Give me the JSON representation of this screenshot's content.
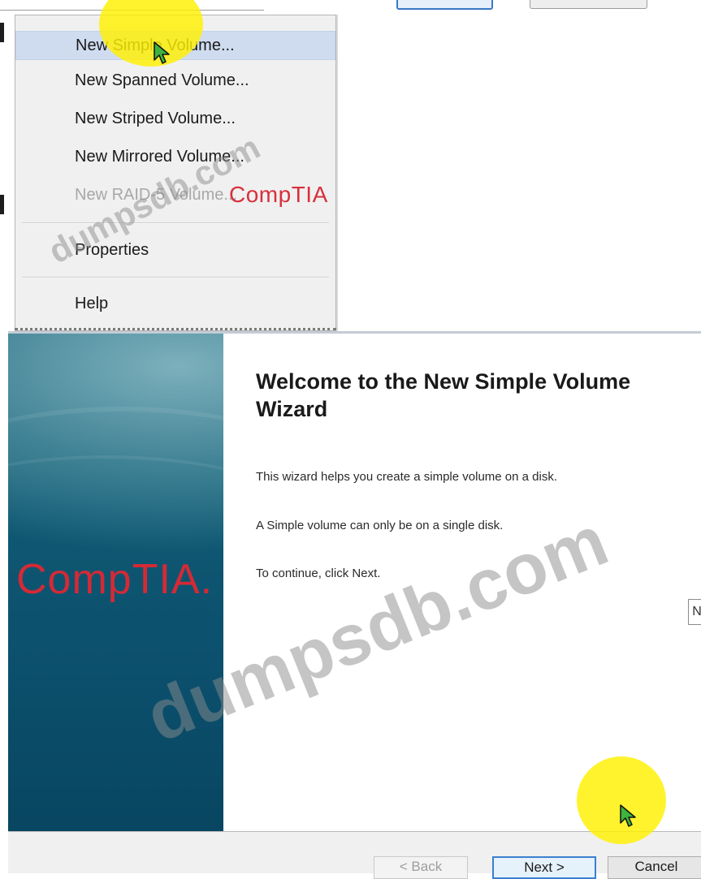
{
  "context_menu": {
    "items": [
      {
        "label": "New Simple Volume...",
        "state": "hover"
      },
      {
        "label": "New Spanned Volume...",
        "state": "enabled"
      },
      {
        "label": "New Striped Volume...",
        "state": "enabled"
      },
      {
        "label": "New Mirrored Volume...",
        "state": "enabled"
      },
      {
        "label": "New RAID-5 Volume...",
        "state": "disabled"
      },
      {
        "label": "Properties",
        "state": "enabled"
      },
      {
        "label": "Help",
        "state": "enabled"
      }
    ]
  },
  "wizard": {
    "title": "Welcome to the New Simple Volume Wizard",
    "paragraphs": [
      "This wizard helps you create a simple volume on a disk.",
      "A Simple volume can only be on a single disk.",
      "To continue, click Next."
    ],
    "side_logo": "CompTIA.",
    "side_stub_text": "N",
    "buttons": {
      "back": "< Back",
      "next": "Next >",
      "cancel": "Cancel"
    }
  },
  "overlays": {
    "menu_logo": "CompTIA",
    "watermark_small": "dumpsdb.com",
    "watermark_large": "dumpsdb.com"
  },
  "colors": {
    "hover_bg": "#cfdcf0",
    "comptia_red": "#d42a36",
    "highlight_yellow": "#fff000",
    "side_panel": "#0b4f6c",
    "primary_button_border": "#3c7fd0"
  }
}
